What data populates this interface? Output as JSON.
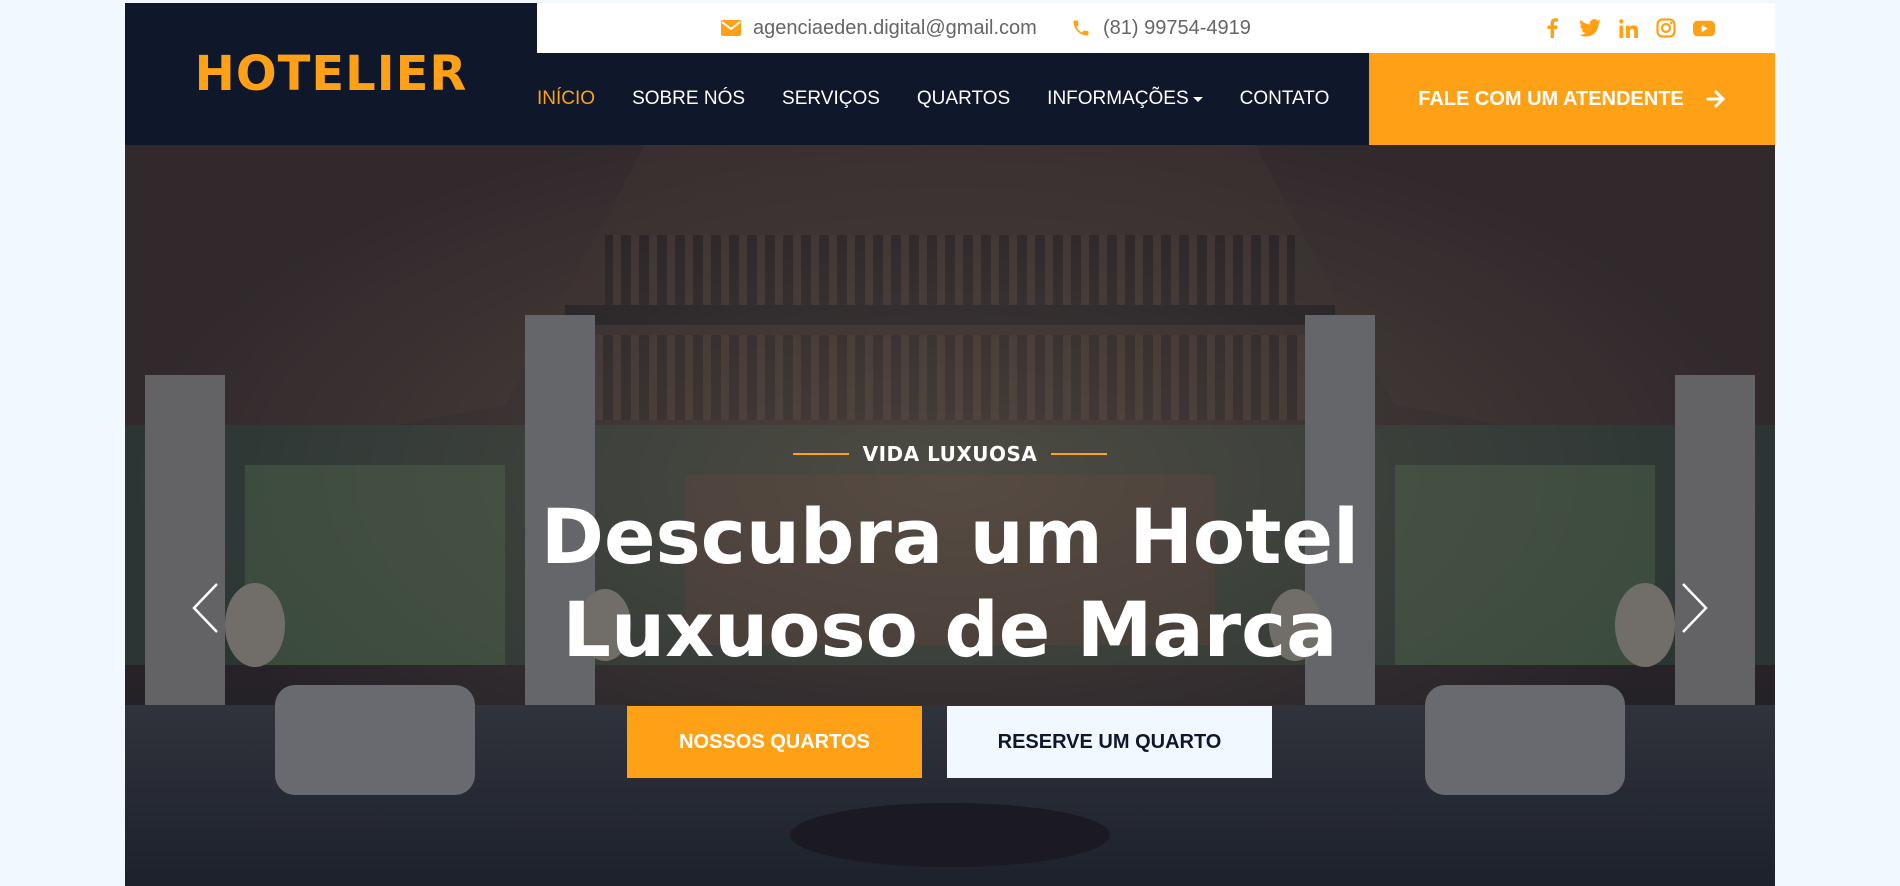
{
  "brand": {
    "logo_text": "HOTELIER"
  },
  "topbar": {
    "email": "agenciaeden.digital@gmail.com",
    "phone": "(81) 99754-4919",
    "social_icons": [
      "facebook-icon",
      "twitter-icon",
      "linkedin-icon",
      "instagram-icon",
      "youtube-icon"
    ]
  },
  "nav": {
    "items": [
      {
        "label": "INÍCIO",
        "active": true
      },
      {
        "label": "SOBRE NÓS"
      },
      {
        "label": "SERVIÇOS"
      },
      {
        "label": "QUARTOS"
      },
      {
        "label": "INFORMAÇÕES",
        "dropdown": true
      },
      {
        "label": "CONTATO"
      }
    ],
    "cta_label": "FALE COM UM ATENDENTE"
  },
  "hero": {
    "kicker": "VIDA LUXUOSA",
    "headline_line1": "Descubra um Hotel",
    "headline_line2": "Luxuoso de Marca",
    "primary_button": "NOSSOS QUARTOS",
    "secondary_button": "RESERVE UM QUARTO"
  },
  "colors": {
    "accent": "#fea116",
    "dark": "#0f172b",
    "light": "#f1f8ff",
    "muted_text": "#666565"
  }
}
